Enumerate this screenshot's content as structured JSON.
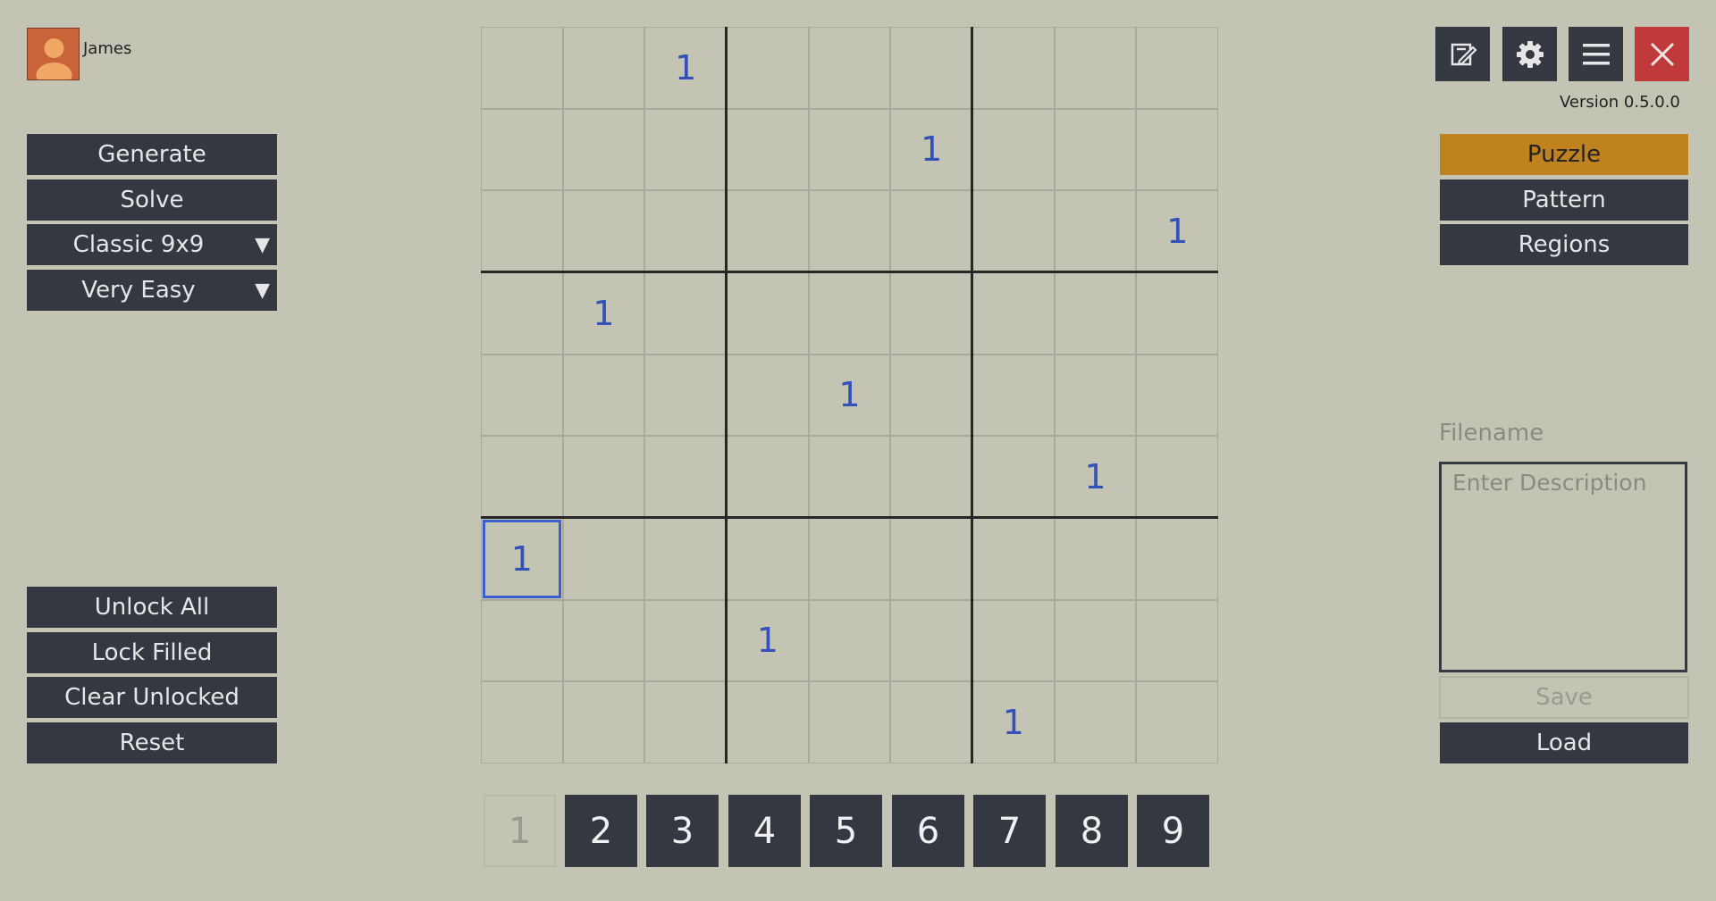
{
  "user": {
    "name": "James",
    "avatar_color": "#c9643a"
  },
  "version": "Version 0.5.0.0",
  "left_panel": {
    "generate_label": "Generate",
    "solve_label": "Solve",
    "variant_selected": "Classic 9x9",
    "difficulty_selected": "Very Easy",
    "unlock_all_label": "Unlock All",
    "lock_filled_label": "Lock Filled",
    "clear_unlocked_label": "Clear Unlocked",
    "reset_label": "Reset"
  },
  "top_icons": [
    "edit-icon",
    "gear-icon",
    "menu-icon",
    "close-icon"
  ],
  "right_panel": {
    "modes": [
      "Puzzle",
      "Pattern",
      "Regions"
    ],
    "active_mode": "Puzzle",
    "filename_label": "Filename",
    "description_placeholder": "Enter Description",
    "description_value": "",
    "save_label": "Save",
    "load_label": "Load"
  },
  "board": {
    "size": 9,
    "cells": [
      [
        "",
        "",
        "1",
        "",
        "",
        "",
        "",
        "",
        ""
      ],
      [
        "",
        "",
        "",
        "",
        "",
        "1",
        "",
        "",
        ""
      ],
      [
        "",
        "",
        "",
        "",
        "",
        "",
        "",
        "",
        "1"
      ],
      [
        "",
        "1",
        "",
        "",
        "",
        "",
        "",
        "",
        ""
      ],
      [
        "",
        "",
        "",
        "",
        "1",
        "",
        "",
        "",
        ""
      ],
      [
        "",
        "",
        "",
        "",
        "",
        "",
        "",
        "1",
        ""
      ],
      [
        "1",
        "",
        "",
        "",
        "",
        "",
        "",
        "",
        ""
      ],
      [
        "",
        "",
        "",
        "1",
        "",
        "",
        "",
        "",
        ""
      ],
      [
        "",
        "",
        "",
        "",
        "",
        "",
        "1",
        "",
        ""
      ]
    ],
    "selected": {
      "row": 7,
      "col": 1
    }
  },
  "number_pad": {
    "numbers": [
      "1",
      "2",
      "3",
      "4",
      "5",
      "6",
      "7",
      "8",
      "9"
    ],
    "disabled": [
      "1"
    ]
  },
  "colors": {
    "background": "#c4c4b5",
    "button": "#343941",
    "accent": "#c0821e",
    "close": "#c0393b",
    "digit": "#3351b8",
    "selection": "#3c5fcf"
  }
}
